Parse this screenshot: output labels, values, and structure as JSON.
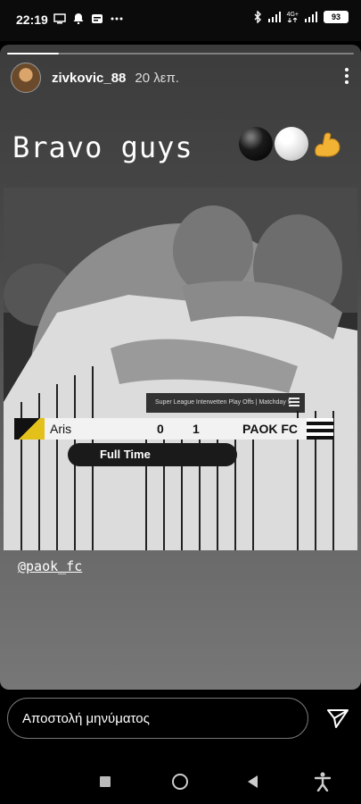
{
  "status_bar": {
    "time": "22:19",
    "battery": "93",
    "network": "4G+",
    "left_icons": [
      "screen-cast-icon",
      "bell-icon",
      "notification-badge-icon",
      "more-dots-icon"
    ],
    "right_icons": [
      "bluetooth-icon",
      "signal-icon",
      "signal-4g-icon",
      "battery-icon"
    ]
  },
  "story": {
    "progress": 0.15,
    "username": "zivkovic_88",
    "time_ago": "20 λεπ.",
    "caption": "Bravo guys",
    "emojis": [
      "black-ball-icon",
      "white-ball-icon",
      "muscle-icon"
    ],
    "mention": "@paok_fc",
    "photo": {
      "league_label": "Super League Interwetten Play Offs | Matchday 5",
      "home_team": "Aris",
      "home_score": "0",
      "away_score": "1",
      "away_team": "PAOK FC",
      "status": "Full Time"
    }
  },
  "message_bar": {
    "placeholder": "Αποστολή μηνύματος"
  },
  "navbar": {
    "buttons": [
      "recents-button",
      "home-button",
      "back-button",
      "accessibility-button"
    ]
  }
}
